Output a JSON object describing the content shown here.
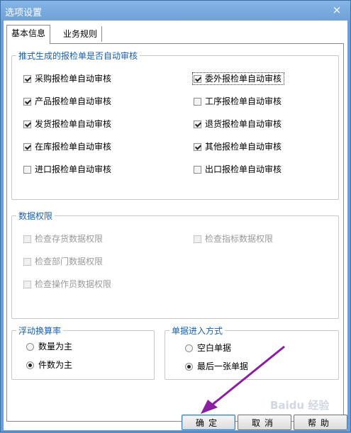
{
  "window": {
    "title": "选项设置",
    "close_label": "×"
  },
  "tabs": [
    {
      "label": "基本信息"
    },
    {
      "label": "业务规则"
    }
  ],
  "auto_audit": {
    "legend": "推式生成的报检单是否自动审核",
    "items": [
      {
        "label": "采购报检单自动审核",
        "checked": true
      },
      {
        "label": "委外报检单自动审核",
        "checked": true
      },
      {
        "label": "产品报检单自动审核",
        "checked": true
      },
      {
        "label": "工序报检单自动审核",
        "checked": false
      },
      {
        "label": "发货报检单自动审核",
        "checked": true
      },
      {
        "label": "退货报检单自动审核",
        "checked": true
      },
      {
        "label": "在库报检单自动审核",
        "checked": true
      },
      {
        "label": "其他报检单自动审核",
        "checked": true
      },
      {
        "label": "进口报检单自动审核",
        "checked": false
      },
      {
        "label": "出口报检单自动审核",
        "checked": false
      }
    ]
  },
  "permissions": {
    "legend": "数据权限",
    "items": [
      {
        "label": "检查存货数据权限",
        "checked": false
      },
      {
        "label": "检查指标数据权限",
        "checked": false
      },
      {
        "label": "检查部门数据权限",
        "checked": false
      },
      {
        "label": "检查操作员数据权限",
        "checked": false
      }
    ]
  },
  "conversion": {
    "legend": "浮动换算率",
    "options": [
      {
        "label": "数量为主",
        "selected": false
      },
      {
        "label": "件数为主",
        "selected": true
      }
    ]
  },
  "entry_mode": {
    "legend": "单据进入方式",
    "options": [
      {
        "label": "空白单据",
        "selected": false
      },
      {
        "label": "最后一张单据",
        "selected": true
      }
    ]
  },
  "buttons": {
    "ok": "确定",
    "cancel": "取消",
    "help": "帮助"
  },
  "watermark": "Baidu 经验"
}
